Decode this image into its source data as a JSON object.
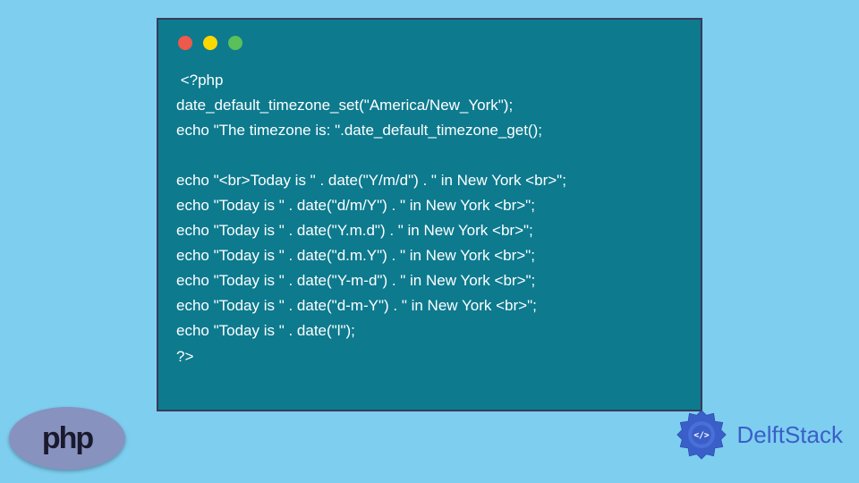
{
  "code": {
    "line1": " <?php",
    "line2": "date_default_timezone_set(\"America/New_York\");",
    "line3": "echo \"The timezone is: \".date_default_timezone_get();",
    "line4": "",
    "line5": "echo \"<br>Today is \" . date(\"Y/m/d\") . \" in New York <br>\";",
    "line6": "echo \"Today is \" . date(\"d/m/Y\") . \" in New York <br>\";",
    "line7": "echo \"Today is \" . date(\"Y.m.d\") . \" in New York <br>\";",
    "line8": "echo \"Today is \" . date(\"d.m.Y\") . \" in New York <br>\";",
    "line9": "echo \"Today is \" . date(\"Y-m-d\") . \" in New York <br>\";",
    "line10": "echo \"Today is \" . date(\"d-m-Y\") . \" in New York <br>\";",
    "line11": "echo \"Today is \" . date(\"l\");",
    "line12": "?>"
  },
  "php_logo_text": "php",
  "delft_logo_text": "DelftStack"
}
